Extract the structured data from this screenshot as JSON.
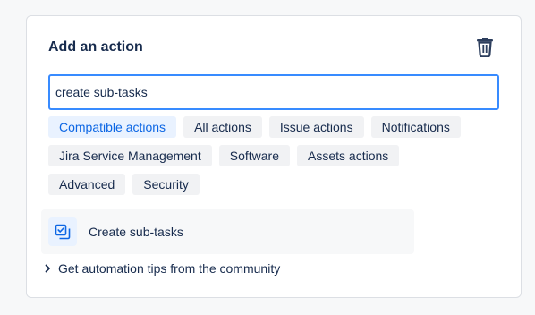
{
  "panel": {
    "title": "Add an action",
    "delete_icon": "trash-icon"
  },
  "search": {
    "value": "create sub-tasks"
  },
  "filters": [
    {
      "label": "Compatible actions",
      "active": true
    },
    {
      "label": "All actions",
      "active": false
    },
    {
      "label": "Issue actions",
      "active": false
    },
    {
      "label": "Notifications",
      "active": false
    },
    {
      "label": "Jira Service Management",
      "active": false
    },
    {
      "label": "Software",
      "active": false
    },
    {
      "label": "Assets actions",
      "active": false
    },
    {
      "label": "Advanced",
      "active": false
    },
    {
      "label": "Security",
      "active": false
    }
  ],
  "results": [
    {
      "label": "Create sub-tasks",
      "icon": "subtask-icon"
    }
  ],
  "tips": {
    "label": "Get automation tips from the community",
    "icon": "chevron-right-icon"
  },
  "colors": {
    "accent": "#0c66e4",
    "focus_border": "#388bff",
    "chip_bg": "#f1f2f4",
    "chip_active_bg": "#e9f2ff",
    "text": "#172b4d"
  }
}
